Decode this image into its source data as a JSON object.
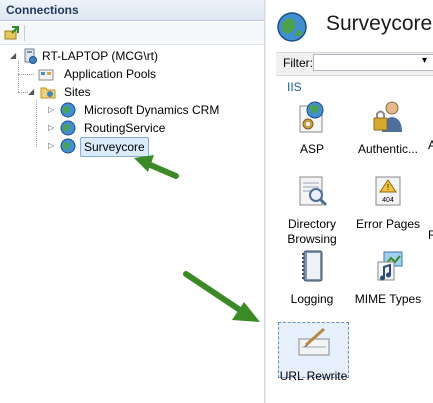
{
  "connections": {
    "header": "Connections",
    "tree": {
      "server": "RT-LAPTOP (MCG\\rt)",
      "app_pools": "Application Pools",
      "sites": "Sites",
      "site_items": [
        "Microsoft Dynamics CRM",
        "RoutingService",
        "Surveycore"
      ]
    }
  },
  "main": {
    "title": "Surveycore H",
    "filter_label": "Filter:",
    "group": "IIS",
    "features": [
      {
        "label": "ASP",
        "icon": "asp-icon"
      },
      {
        "label": "Authentic...",
        "icon": "authentication-icon"
      },
      {
        "label": "A",
        "icon": "cut-off-icon"
      },
      {
        "label": "Directory Browsing",
        "icon": "directory-browsing-icon"
      },
      {
        "label": "Error Pages",
        "icon": "error-pages-icon"
      },
      {
        "label": "R",
        "icon": "cut-off-icon"
      },
      {
        "label": "Logging",
        "icon": "logging-icon"
      },
      {
        "label": "MIME Types",
        "icon": "mime-types-icon"
      },
      {
        "label": "URL Rewrite",
        "icon": "url-rewrite-icon"
      }
    ],
    "error_badge": "404"
  },
  "colors": {
    "arrow": "#3a8a26",
    "selection": "#dcebfc"
  }
}
